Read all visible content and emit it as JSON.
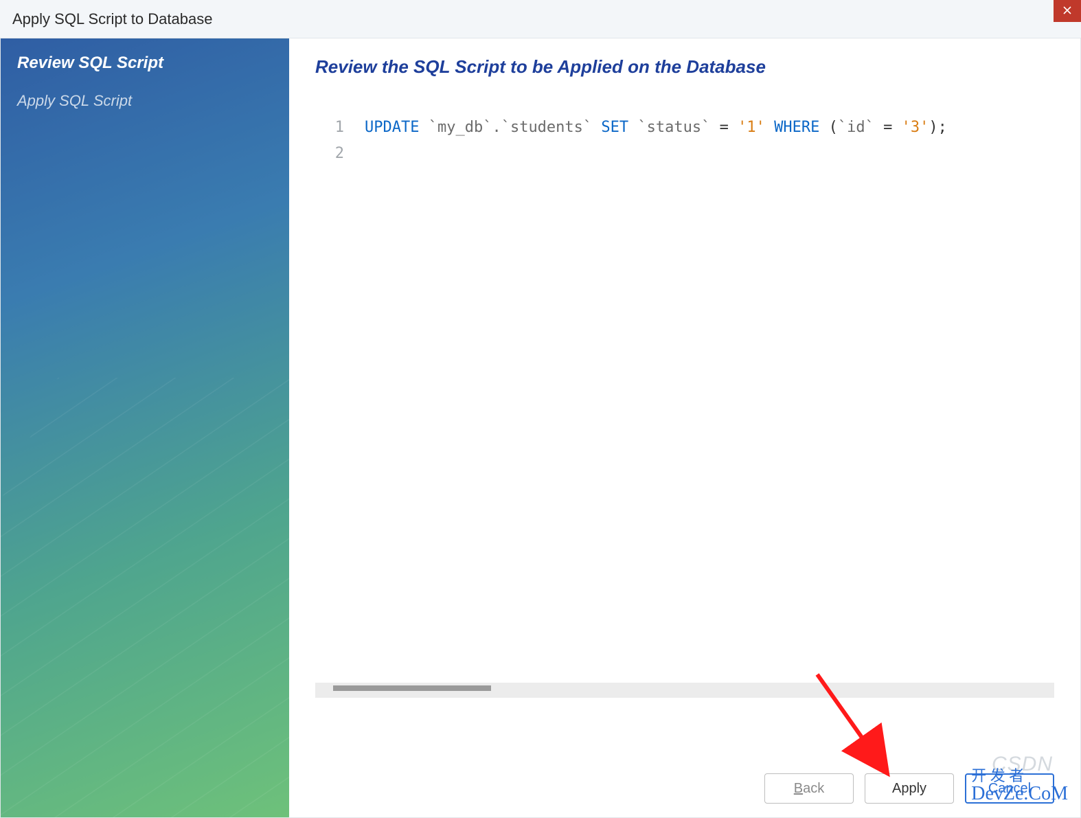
{
  "window": {
    "title": "Apply SQL Script to Database"
  },
  "sidebar": {
    "steps": [
      {
        "label": "Review SQL Script",
        "active": true
      },
      {
        "label": "Apply SQL Script",
        "active": false
      }
    ]
  },
  "main": {
    "heading": "Review the SQL Script to be Applied on the Database"
  },
  "sql": {
    "lines": [
      "1",
      "2"
    ],
    "tokens": {
      "update": "UPDATE",
      "db": "`my_db`",
      "dot": ".",
      "table": "`students`",
      "set": "SET",
      "col1": "`status`",
      "eq1": " = ",
      "val1": "'1'",
      "where": "WHERE",
      "lp": " (",
      "col2": "`id`",
      "eq2": " = ",
      "val2": "'3'",
      "rp": ");"
    }
  },
  "footer": {
    "back": "Back",
    "apply": "Apply",
    "cancel": "Cancel"
  },
  "watermark": {
    "csdn": "CSDN",
    "top": "开 发 者",
    "bottom": "DevZe.CoM"
  }
}
